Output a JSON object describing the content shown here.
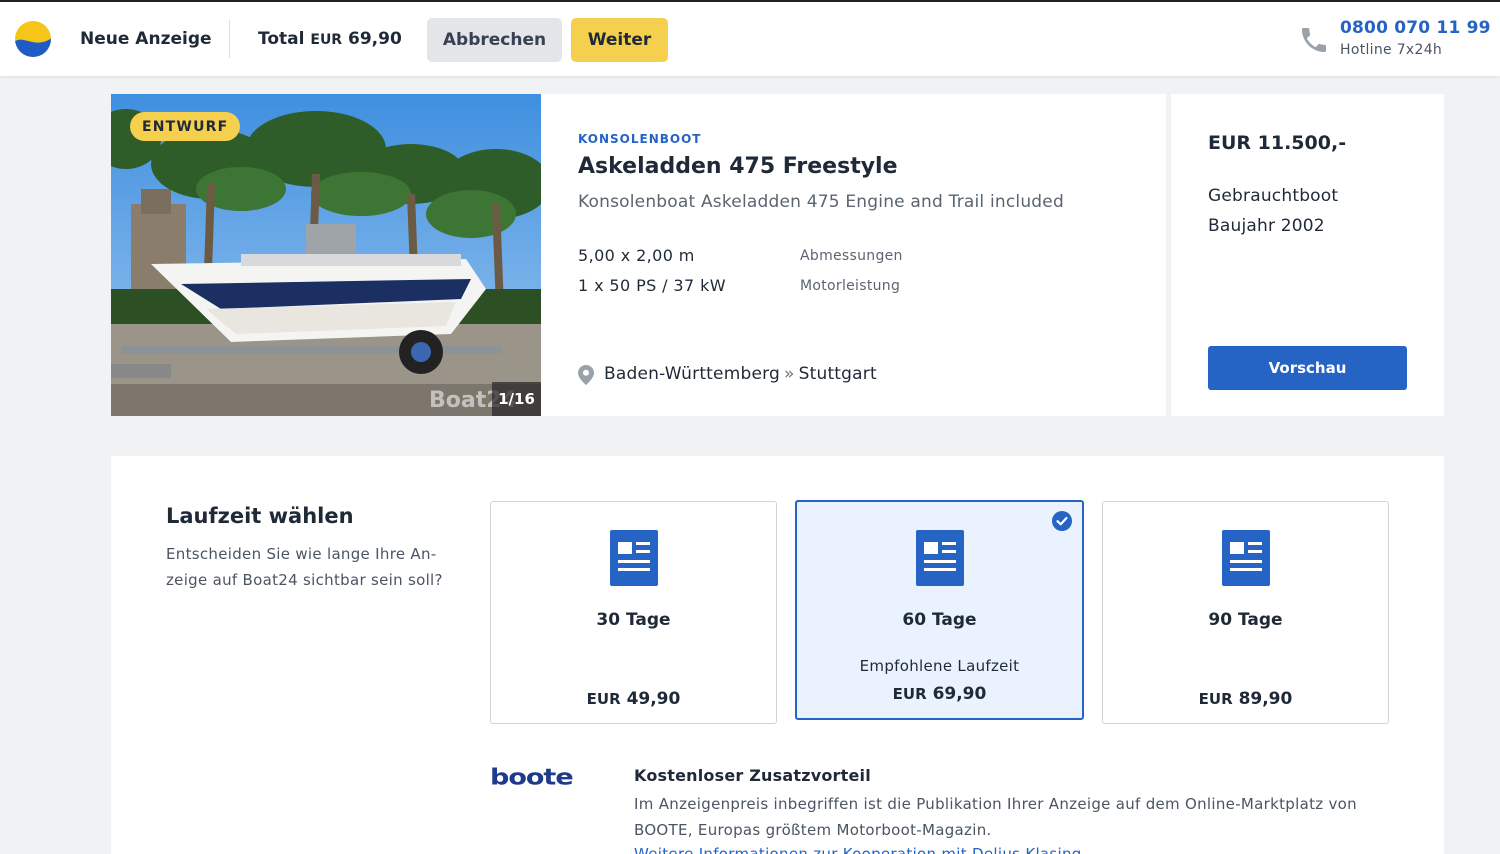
{
  "header": {
    "title": "Neue Anzeige",
    "total_label": "Total",
    "total_currency": "EUR",
    "total_amount": "69,90",
    "cancel_label": "Abbrechen",
    "next_label": "Weiter",
    "hotline_number": "0800 070 11 99",
    "hotline_label": "Hotline 7x24h"
  },
  "listing": {
    "badge": "ENTWURF",
    "photo_counter": "1/16",
    "photo_watermark": "Boat24",
    "category": "KONSOLENBOOT",
    "title": "Askeladden 475 Freestyle",
    "subtitle": "Konsolenboat Askeladden 475 Engine and Trail included",
    "specs": [
      {
        "value": "5,00 x 2,00 m",
        "label": "Abmessungen"
      },
      {
        "value": "1 x 50 PS / 37 kW",
        "label": "Motorleistung"
      }
    ],
    "location_region": "Baden-Württemberg",
    "location_sep": "»",
    "location_city": "Stuttgart",
    "price": "EUR 11.500,-",
    "condition": "Gebrauchtboot",
    "year": "Baujahr 2002",
    "preview_label": "Vorschau"
  },
  "duration": {
    "title": "Laufzeit wählen",
    "description": "Entscheiden Sie wie lange Ihre An-zeige auf Boat24 sichtbar sein soll?",
    "options": [
      {
        "days": "30 Tage",
        "recommended": "",
        "currency": "EUR",
        "price": "49,90",
        "selected": false
      },
      {
        "days": "60 Tage",
        "recommended": "Empfohlene Laufzeit",
        "currency": "EUR",
        "price": "69,90",
        "selected": true
      },
      {
        "days": "90 Tage",
        "recommended": "",
        "currency": "EUR",
        "price": "89,90",
        "selected": false
      }
    ]
  },
  "extra": {
    "logo_text": "boote",
    "title": "Kostenloser Zusatzvorteil",
    "text": "Im Anzeigenpreis inbegriffen ist die Publikation Ihrer Anzeige auf dem Online-Marktplatz von BOOTE, Europas größtem Motorboot-Magazin.",
    "link": "Weitere Informationen zur Kooperation mit Delius Klasing"
  },
  "colors": {
    "accent_blue": "#2563c4",
    "accent_yellow": "#f5d04e",
    "selected_bg": "#eaf2fd"
  },
  "icons": [
    "logo-icon",
    "phone-icon",
    "location-pin-icon",
    "document-icon",
    "check-circle-icon"
  ]
}
